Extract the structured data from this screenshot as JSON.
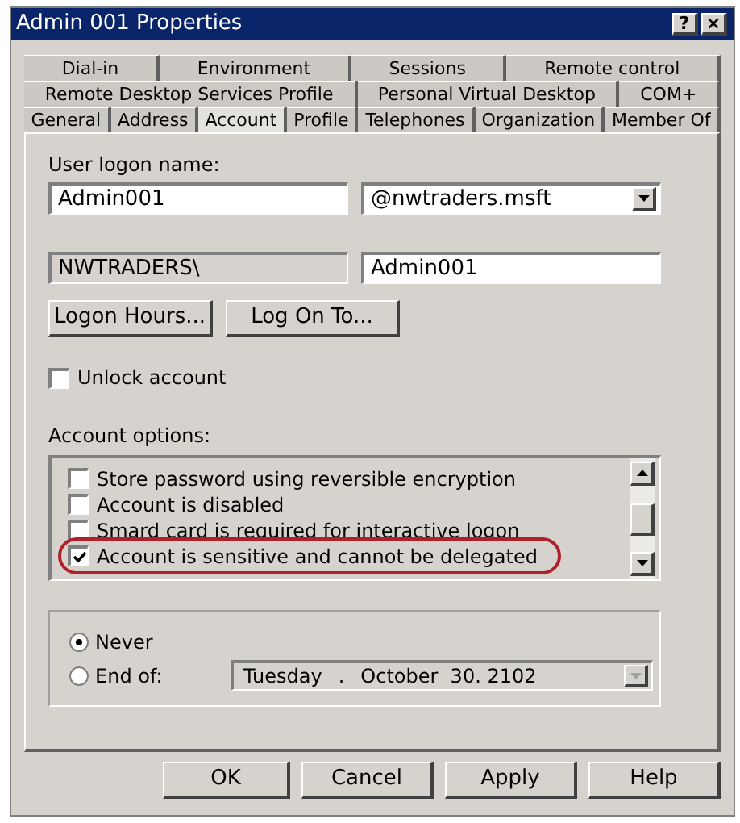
{
  "window": {
    "title": "Admin 001 Properties",
    "controls": [
      "?",
      "×"
    ]
  },
  "tab_rows": [
    [
      {
        "label": "Dial-in",
        "selected": false
      },
      {
        "label": "Environment",
        "selected": false
      },
      {
        "label": "Sessions",
        "selected": false
      },
      {
        "label": "Remote control",
        "selected": false
      }
    ],
    [
      {
        "label": "Remote Desktop Services Profile",
        "selected": false
      },
      {
        "label": "Personal Virtual Desktop",
        "selected": false
      },
      {
        "label": "COM+",
        "selected": false
      }
    ],
    [
      {
        "label": "General",
        "selected": false
      },
      {
        "label": "Address",
        "selected": false
      },
      {
        "label": "Account",
        "selected": true
      },
      {
        "label": "Profile",
        "selected": false
      },
      {
        "label": "Telephones",
        "selected": false
      },
      {
        "label": "Organization",
        "selected": false
      },
      {
        "label": "Member Of",
        "selected": false
      }
    ]
  ],
  "logon": {
    "label": "User logon name:",
    "name": "Admin001",
    "domain": "@nwtraders.msft",
    "pre2000_domain": "NWTRADERS\\",
    "pre2000_name": "Admin001"
  },
  "buttons_row": [
    "Logon Hours...",
    "Log On To..."
  ],
  "unlock": {
    "label": "Unlock account",
    "checked": false
  },
  "account_options": {
    "label": "Account options:",
    "items": [
      {
        "label": "Store password using reversible encryption",
        "checked": false,
        "highlighted": false
      },
      {
        "label": "Account is disabled",
        "checked": false,
        "highlighted": false
      },
      {
        "label": "Smard card is required for interactive logon",
        "checked": false,
        "highlighted": false
      },
      {
        "label": "Account is sensitive and cannot be delegated",
        "checked": true,
        "highlighted": true
      }
    ]
  },
  "expires": {
    "options": [
      {
        "label": "Never",
        "selected": true
      },
      {
        "label": "End of:",
        "selected": false
      }
    ],
    "date": {
      "weekday": "Tuesday",
      "separator": ".",
      "month": "October",
      "day": "30.",
      "year": "2102"
    }
  },
  "footer_buttons": [
    "OK",
    "Cancel",
    "Apply",
    "Help"
  ]
}
